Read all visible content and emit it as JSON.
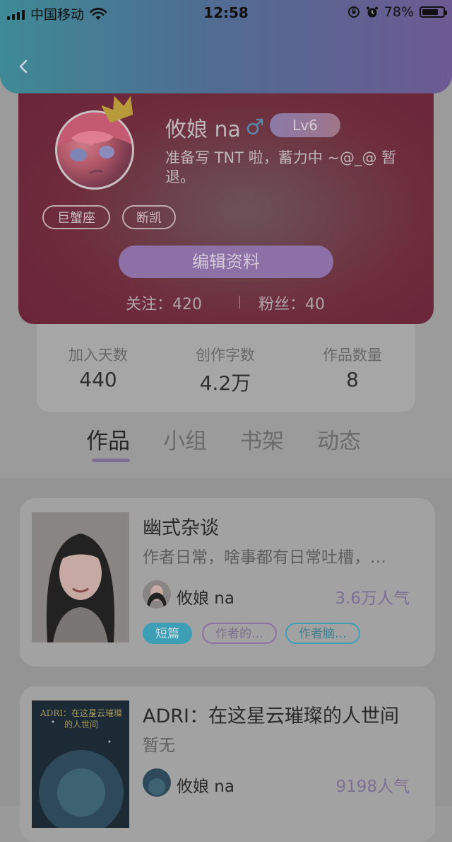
{
  "status_bar": {
    "carrier": "中国移动",
    "time": "12:58",
    "battery_percent": "78%",
    "battery_level": 0.78
  },
  "profile": {
    "nickname": "攸娘 na",
    "gender_icon": "male-icon",
    "level": "Lv6",
    "bio": "准备写 TNT 啦，蓄力中 ~@_@ 暂退。",
    "tags": [
      "巨蟹座",
      "断凯"
    ],
    "edit_button": "编辑资料",
    "following": "关注：420",
    "followers": "粉丝：40"
  },
  "stats": [
    {
      "label": "加入天数",
      "value": "440"
    },
    {
      "label": "创作字数",
      "value": "4.2万"
    },
    {
      "label": "作品数量",
      "value": "8"
    }
  ],
  "tabs": [
    {
      "label": "作品",
      "active": true
    },
    {
      "label": "小组",
      "active": false
    },
    {
      "label": "书架",
      "active": false
    },
    {
      "label": "动态",
      "active": false
    }
  ],
  "works": [
    {
      "title": "幽式杂谈",
      "desc": "作者日常，啥事都有日常吐槽，…",
      "author": "攸娘 na",
      "popularity": "3.6万人气",
      "tags": [
        {
          "label": "短篇",
          "style": "filled-teal"
        },
        {
          "label": "作者的…",
          "style": "outline-purple"
        },
        {
          "label": "作者脑…",
          "style": "outline-teal"
        }
      ]
    },
    {
      "title": "ADRI：在这星云璀璨的人世间",
      "desc": "暂无",
      "author": "攸娘 na",
      "popularity": "9198人气",
      "cover_text": "ADRI：在这星云璀璨的人世间",
      "tags": []
    }
  ],
  "colors": {
    "header_gradient": [
      "#3e8a96",
      "#6c5a92"
    ],
    "accent_purple": "#8c70a6",
    "tag_teal": "#3d9fb6"
  }
}
